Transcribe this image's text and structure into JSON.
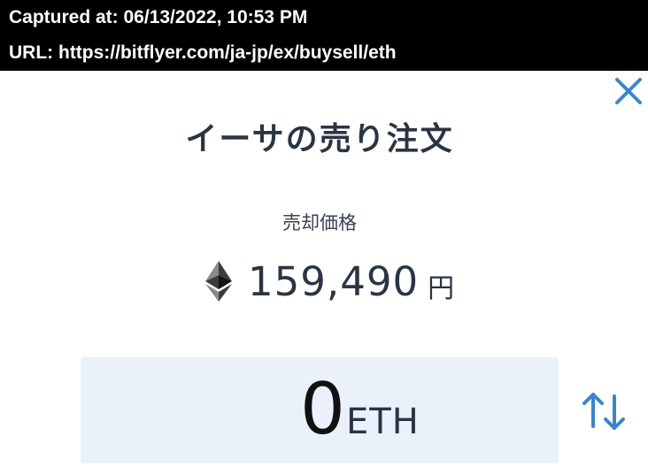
{
  "capture": {
    "captured_at": "Captured at: 06/13/2022, 10:53 PM",
    "url": "URL: https://bitflyer.com/ja-jp/ex/buysell/eth"
  },
  "dialog": {
    "title": "イーサの売り注文",
    "close_icon": "close-icon",
    "price_label": "売却価格",
    "price_value": "159,490",
    "price_unit": "円",
    "currency_icon": "ethereum-icon",
    "amount_value": "0",
    "amount_unit": "ETH",
    "swap_icon": "swap-arrows-icon"
  },
  "colors": {
    "accent": "#3a86c8",
    "title_text": "#2b3442",
    "input_bg": "#eaf1fa",
    "capture_bar_bg": "#000000"
  }
}
